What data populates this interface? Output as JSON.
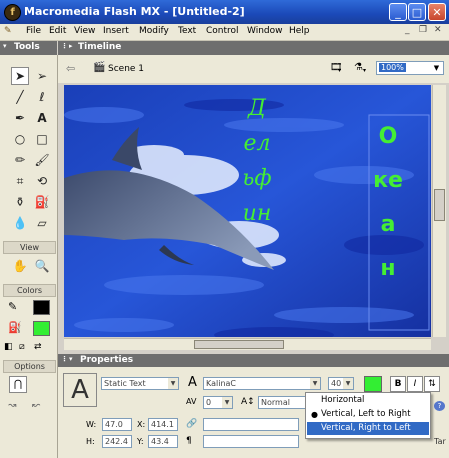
{
  "window": {
    "title": "Macromedia Flash MX - [Untitled-2]",
    "icon_name": "flash-app-icon"
  },
  "menu": {
    "items": [
      "File",
      "Edit",
      "View",
      "Insert",
      "Modify",
      "Text",
      "Control",
      "Window",
      "Help"
    ]
  },
  "tools": {
    "title": "Tools",
    "view_label": "View",
    "colors_label": "Colors",
    "options_label": "Options",
    "stroke_color": "#000000",
    "fill_color": "#33ee33"
  },
  "timeline": {
    "title": "Timeline",
    "scene": "Scene 1",
    "zoom": "100%"
  },
  "stage": {
    "vertical_left_text": "Дельфин",
    "vertical_right_text": "Океан",
    "text_color": "#44ee33",
    "water_color": "#1f47c8"
  },
  "properties": {
    "title": "Properties",
    "text_type": "Static Text",
    "font": "KalinaC",
    "font_size": "40",
    "spacing": "0",
    "baseline": "Normal",
    "width_label": "W:",
    "width": "47.0",
    "height_label": "H:",
    "height": "242.4",
    "x_label": "X:",
    "x": "414.1",
    "y_label": "Y:",
    "y": "43.4",
    "bold": "B",
    "italic": "I",
    "fill_color": "#33ee33",
    "trailing_text": "Tar"
  },
  "direction_menu": {
    "items": [
      "Horizontal",
      "Vertical, Left to Right",
      "Vertical, Right to Left"
    ],
    "checked_index": 1,
    "highlighted_index": 2
  }
}
